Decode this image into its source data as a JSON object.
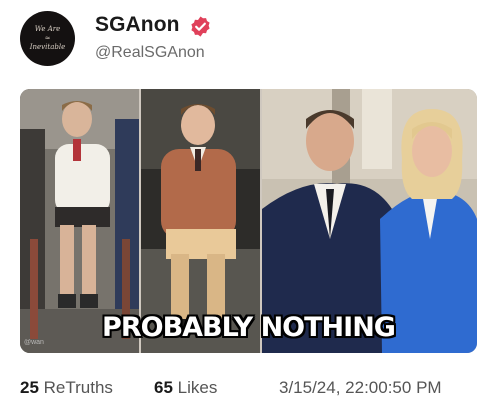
{
  "author": {
    "display_name": "SGAnon",
    "handle": "@RealSGAnon",
    "verified": true,
    "avatar_text": [
      "We Are",
      "Inevitable"
    ],
    "verified_color": "#e0405a"
  },
  "media": {
    "caption": "PROBABLY NOTHING",
    "watermark": "@wan"
  },
  "stats": {
    "retruths_count": "25",
    "retruths_label": "ReTruths",
    "likes_count": "65",
    "likes_label": "Likes",
    "timestamp": "3/15/24, 22:00:50 PM"
  }
}
